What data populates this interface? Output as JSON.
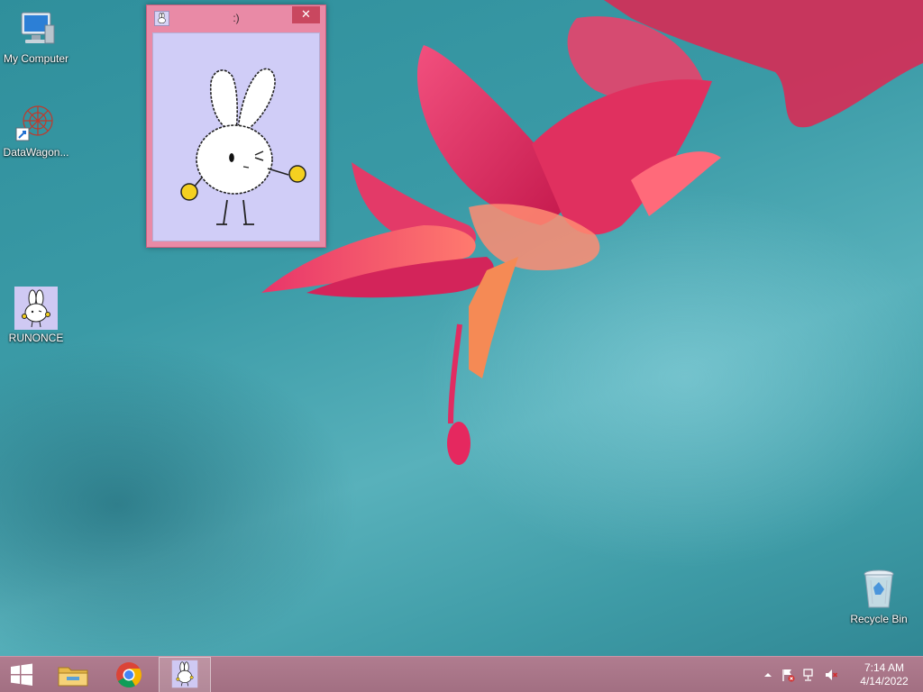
{
  "desktop": {
    "icons": [
      {
        "label": "My Computer",
        "icon": "computer-icon"
      },
      {
        "label": "DataWagon...",
        "icon": "datawagon-icon"
      },
      {
        "label": "RUNONCE",
        "icon": "bunny-icon"
      },
      {
        "label": "Recycle Bin",
        "icon": "recycle-bin-icon"
      }
    ]
  },
  "window": {
    "title": ":)",
    "close_glyph": "✕",
    "icon": "bunny-icon"
  },
  "taskbar": {
    "start_icon": "windows-logo-icon",
    "apps": [
      {
        "icon": "file-explorer-icon"
      },
      {
        "icon": "chrome-icon"
      },
      {
        "icon": "bunny-icon",
        "active": true
      }
    ],
    "tray": {
      "icons": [
        "show-hidden-icons-arrow",
        "action-center-flag-icon",
        "network-icon",
        "volume-muted-icon"
      ],
      "time": "7:14 AM",
      "date": "4/14/2022"
    }
  },
  "colors": {
    "taskbar": "#a87588",
    "window_frame": "#e98aa6",
    "window_client": "#d0cdf7",
    "close_button": "#c9475f",
    "flower": "#e23a6a"
  }
}
